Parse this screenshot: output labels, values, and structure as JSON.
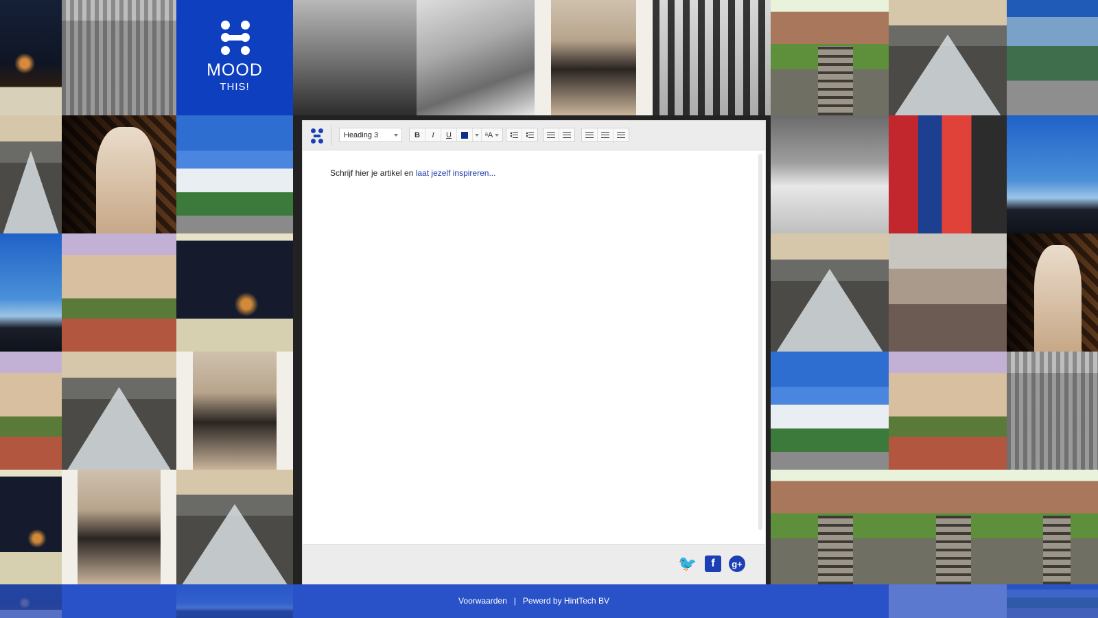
{
  "logo": {
    "title": "MOOD",
    "subtitle": "THIS!"
  },
  "toolbar": {
    "format_select": "Heading 3",
    "bold": "B",
    "italic": "I",
    "underline": "U",
    "font_size_label": "ᵃA"
  },
  "editor": {
    "placeholder_start": "Schrijf hier je artikel en ",
    "placeholder_link": "laat jezelf inspireren..."
  },
  "social": {
    "twitter": "🐦",
    "facebook": "f",
    "google": "g+"
  },
  "footer": {
    "terms": "Voorwaarden",
    "separator": "|",
    "powered": "Pewerd by HintTech BV"
  },
  "colors": {
    "brand_blue": "#0d3fbf",
    "footer_blue": "#2a52c8",
    "accent": "#1c3fb6"
  }
}
